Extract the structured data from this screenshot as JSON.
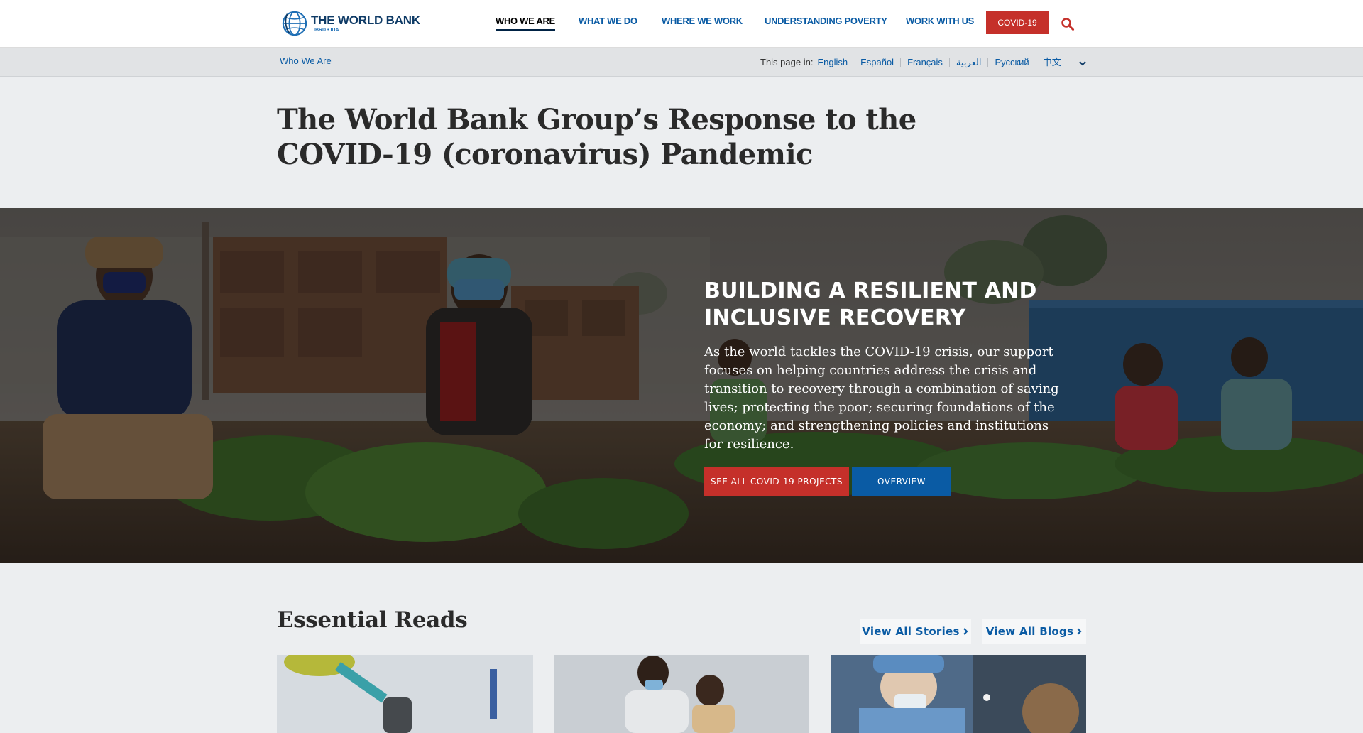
{
  "header": {
    "logo_name": "THE WORLD BANK",
    "logo_sub": "IBRD • IDA",
    "nav": [
      {
        "label": "WHO WE ARE",
        "active": true
      },
      {
        "label": "WHAT WE DO",
        "active": false
      },
      {
        "label": "WHERE WE WORK",
        "active": false
      },
      {
        "label": "UNDERSTANDING POVERTY",
        "active": false
      },
      {
        "label": "WORK WITH US",
        "active": false
      }
    ],
    "covid_label": "COVID-19",
    "search_icon": "search-icon"
  },
  "subnav": {
    "breadcrumb": "Who We Are",
    "lang_label": "This page in:",
    "languages": [
      "English",
      "Español",
      "Français",
      "العربية",
      "Русский",
      "中文"
    ],
    "more_icon": "chevron-down-icon"
  },
  "page": {
    "title": "The World Bank Group’s Response to the COVID-19 (coronavirus) Pandemic"
  },
  "hero": {
    "heading": "BUILDING A RESILIENT AND INCLUSIVE RECOVERY",
    "body": "As the world tackles the COVID-19 crisis, our support focuses on helping countries address the crisis and transition to recovery through a combination of saving lives; protecting the poor; securing foundations of the economy; and strengthening policies and institutions for resilience.",
    "primary_button": "SEE ALL COVID-19 PROJECTS",
    "secondary_button": "OVERVIEW"
  },
  "essential_reads": {
    "title": "Essential Reads",
    "view_stories": "View All Stories",
    "view_blogs": "View All Blogs",
    "chevron_icon": "chevron-right-icon"
  },
  "colors": {
    "brand_blue": "#0a5ba4",
    "brand_red": "#c5302a",
    "navy": "#002244"
  }
}
